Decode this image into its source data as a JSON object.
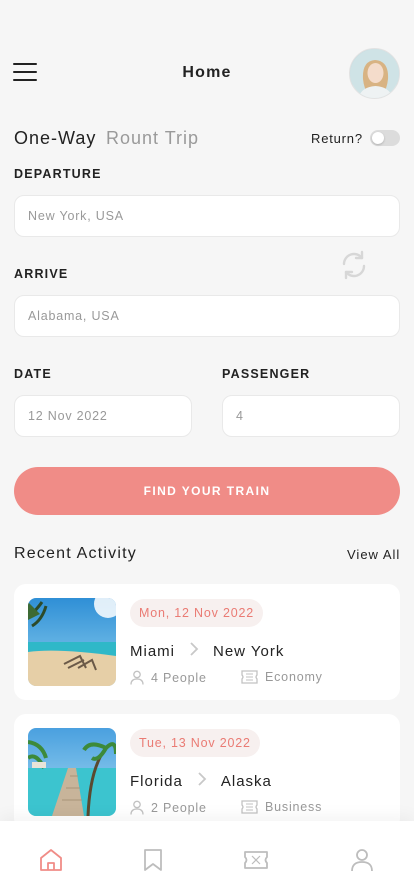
{
  "header": {
    "title": "Home",
    "menu_icon": "hamburger-menu-icon",
    "avatar_icon": "user-avatar"
  },
  "trip_type": {
    "one_way": "One-Way",
    "round_trip": "Rount Trip",
    "selected": "One-Way",
    "return_label": "Return?",
    "return_enabled": false
  },
  "form": {
    "departure_label": "DEPARTURE",
    "departure_value": "New York, USA",
    "arrive_label": "ARRIVE",
    "arrive_value": "Alabama, USA",
    "date_label": "DATE",
    "date_value": "12 Nov 2022",
    "passenger_label": "PASSENGER",
    "passenger_value": "4",
    "swap_icon": "swap-refresh-icon",
    "submit_label": "FIND YOUR TRAIN"
  },
  "recent": {
    "title": "Recent Activity",
    "view_all": "View All",
    "items": [
      {
        "date": "Mon, 12 Nov 2022",
        "from": "Miami",
        "to": "New York",
        "people": "4 People",
        "class": "Economy",
        "image": "beach-chairs-photo"
      },
      {
        "date": "Tue, 13 Nov 2022",
        "from": "Florida",
        "to": "Alaska",
        "people": "2 People",
        "class": "Business",
        "image": "tropical-pier-photo"
      }
    ]
  },
  "bottom_nav": [
    {
      "icon": "home-icon",
      "active": true
    },
    {
      "icon": "bookmark-icon",
      "active": false
    },
    {
      "icon": "ticket-icon",
      "active": false
    },
    {
      "icon": "profile-icon",
      "active": false
    }
  ],
  "colors": {
    "accent": "#f08c87",
    "accent_text": "#ea7b74",
    "background": "#f6f6f6",
    "muted": "#999999"
  }
}
